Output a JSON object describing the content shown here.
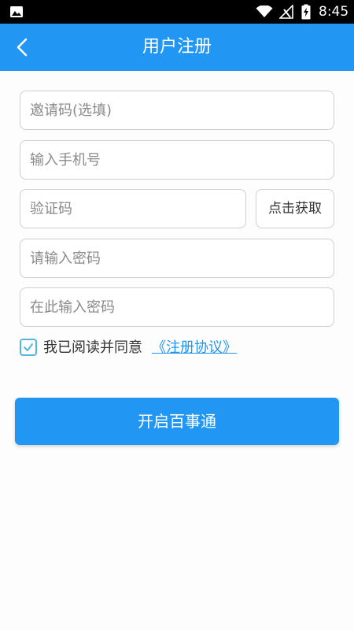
{
  "status_bar": {
    "time": "8:45",
    "icons": [
      "gallery-icon",
      "wifi-icon",
      "no-signal-icon",
      "battery-charging-icon"
    ]
  },
  "app_bar": {
    "title": "用户注册",
    "back_icon": "chevron-left-icon",
    "background": "#2196f3"
  },
  "form": {
    "invite_code": {
      "placeholder": "邀请码(选填)",
      "value": ""
    },
    "phone": {
      "placeholder": "输入手机号",
      "value": ""
    },
    "verify_code": {
      "placeholder": "验证码",
      "value": ""
    },
    "get_code_label": "点击获取",
    "password": {
      "placeholder": "请输入密码",
      "value": ""
    },
    "password_confirm": {
      "placeholder": "在此输入密码",
      "value": ""
    }
  },
  "agreement": {
    "checked": true,
    "text": "我已阅读并同意",
    "link_text": "《注册协议》"
  },
  "submit": {
    "label": "开启百事通"
  },
  "colors": {
    "primary": "#2196f3",
    "checkbox": "#51b7dd"
  }
}
